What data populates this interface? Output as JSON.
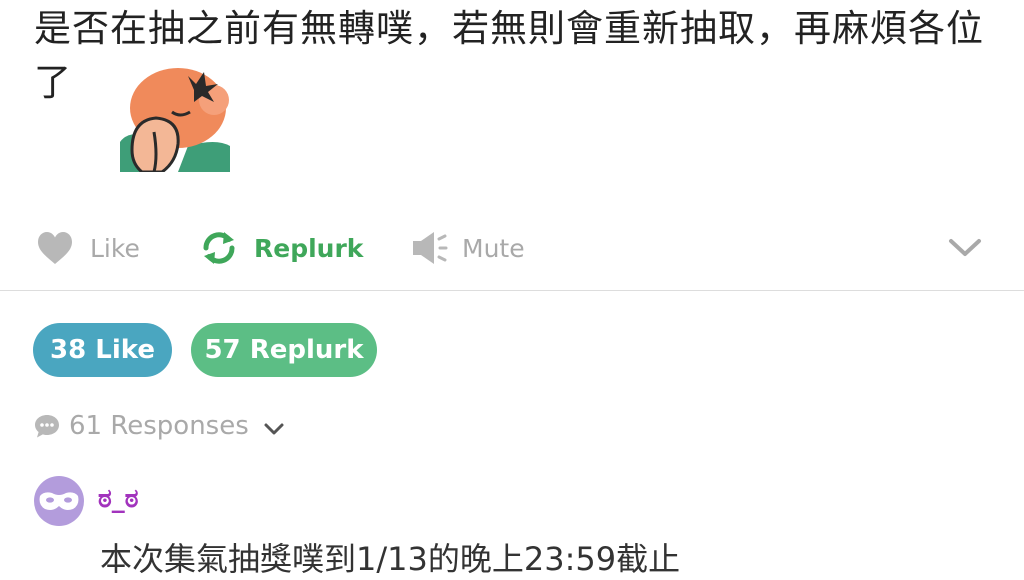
{
  "post": {
    "text": "是否在抽之前有無轉噗，若無則會重新抽取，再麻煩各位了"
  },
  "actions": {
    "like_label": "Like",
    "replurk_label": "Replurk",
    "mute_label": "Mute"
  },
  "stats": {
    "like_badge": "38 Like",
    "replurk_badge": "57 Replurk"
  },
  "responses": {
    "label": "61 Responses"
  },
  "reply": {
    "username": "ಠ_ಠ",
    "text": "本次集氣抽獎噗到1/13的晚上23:59截止"
  },
  "colors": {
    "replurk_green": "#3fa75a",
    "like_badge_bg": "#4aa6c0",
    "replurk_badge_bg": "#5cbe85",
    "username_purple": "#a233bd",
    "avatar_bg": "#b39cdc",
    "muted_gray": "#a9a9a9"
  },
  "icons": [
    "heart-icon",
    "replurk-arrows-icon",
    "speaker-mute-icon",
    "chevron-down-icon",
    "speech-bubble-icon",
    "mask-avatar-icon",
    "sticker-image"
  ]
}
